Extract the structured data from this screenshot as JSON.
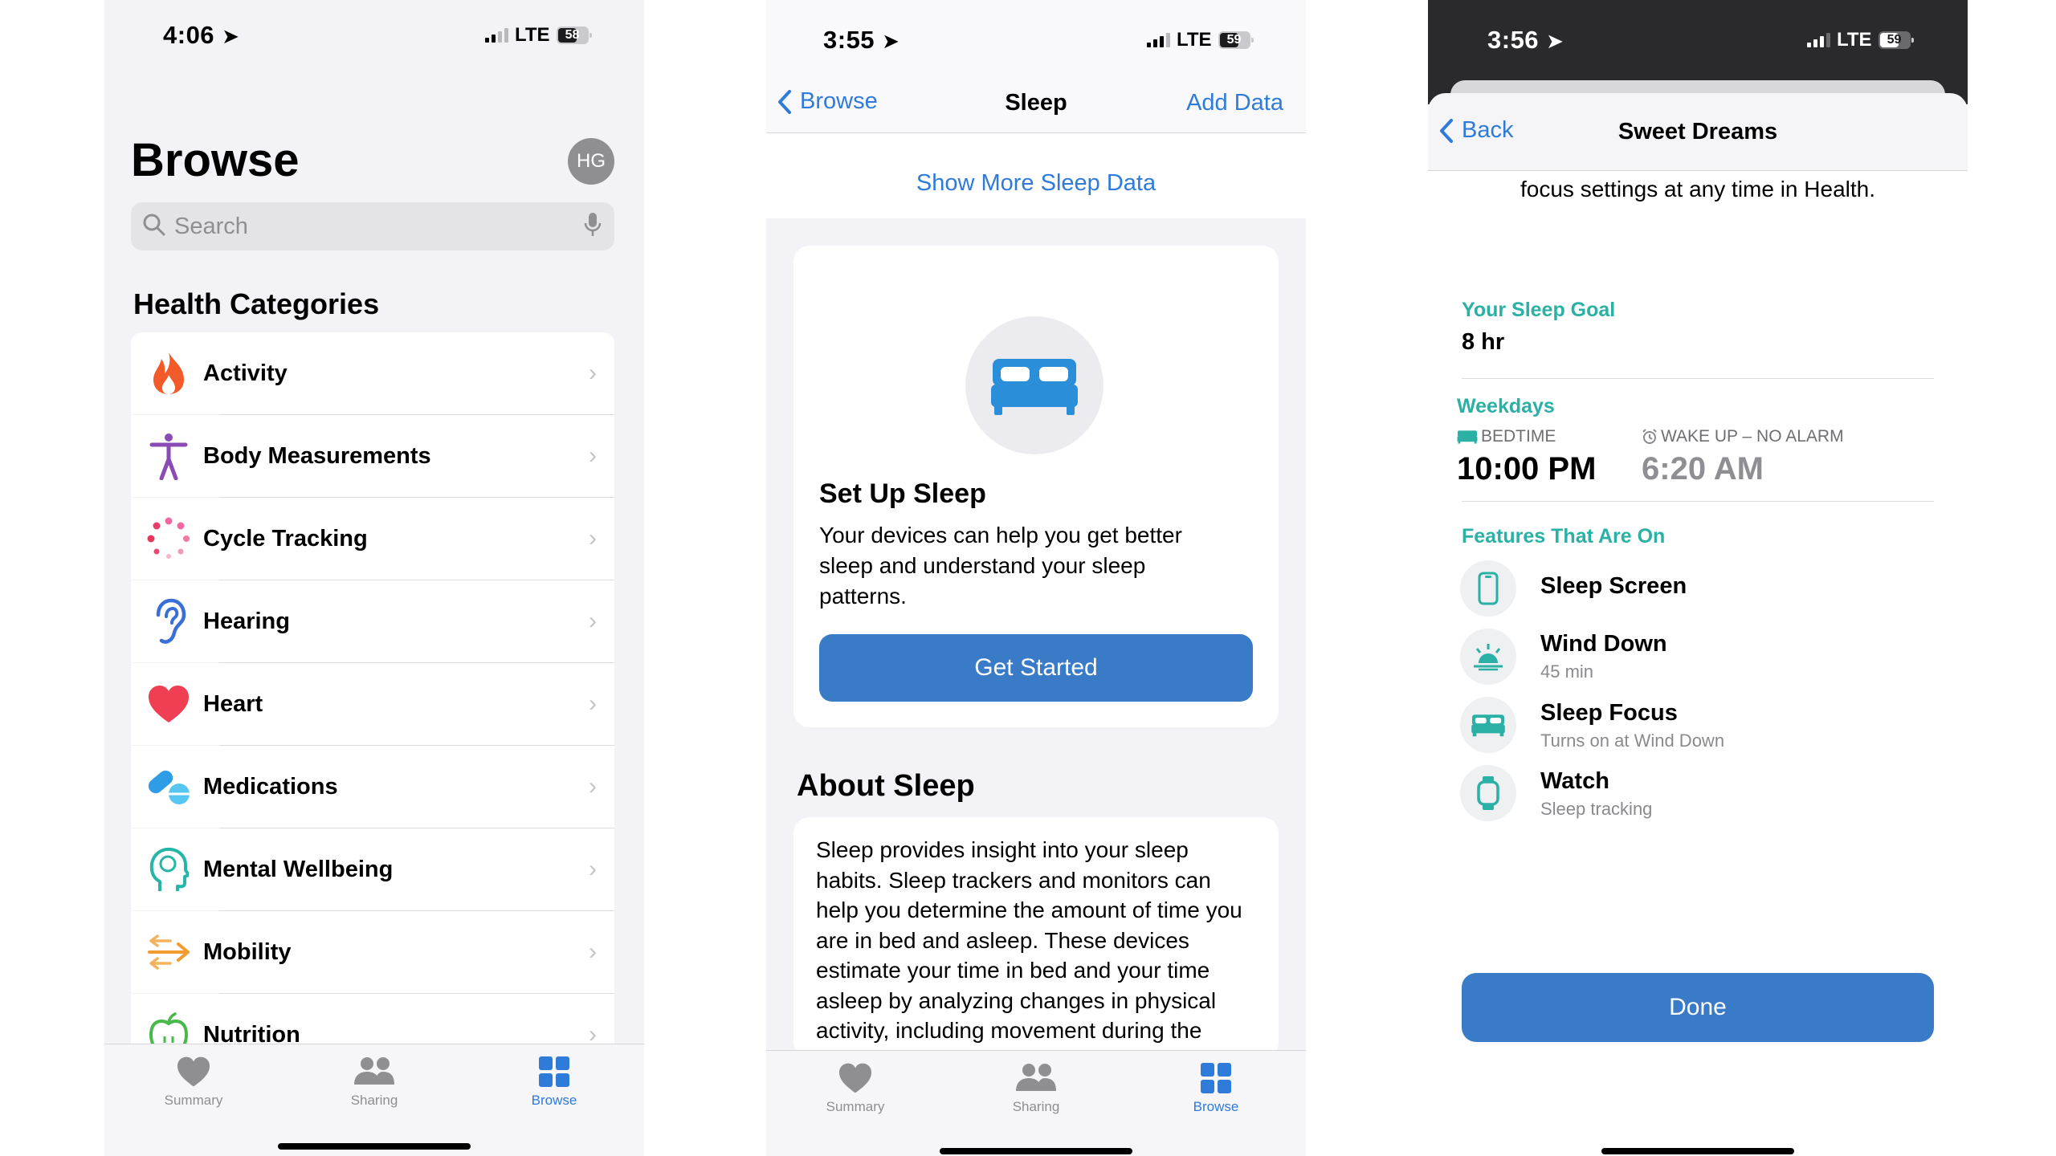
{
  "screen1": {
    "status": {
      "time": "4:06",
      "network": "LTE",
      "battery": "58"
    },
    "title": "Browse",
    "avatar": "HG",
    "search": {
      "placeholder": "Search"
    },
    "section_title": "Health Categories",
    "categories": [
      {
        "label": "Activity",
        "icon": "flame-icon"
      },
      {
        "label": "Body Measurements",
        "icon": "figure-icon"
      },
      {
        "label": "Cycle Tracking",
        "icon": "cycle-dots-icon"
      },
      {
        "label": "Hearing",
        "icon": "ear-icon"
      },
      {
        "label": "Heart",
        "icon": "heart-icon"
      },
      {
        "label": "Medications",
        "icon": "pills-icon"
      },
      {
        "label": "Mental Wellbeing",
        "icon": "head-brain-icon"
      },
      {
        "label": "Mobility",
        "icon": "arrows-icon"
      },
      {
        "label": "Nutrition",
        "icon": "apple-icon"
      }
    ],
    "tabs": [
      {
        "label": "Summary",
        "icon": "heart-icon"
      },
      {
        "label": "Sharing",
        "icon": "people-icon"
      },
      {
        "label": "Browse",
        "icon": "grid-icon"
      }
    ]
  },
  "screen2": {
    "status": {
      "time": "3:55",
      "network": "LTE",
      "battery": "59"
    },
    "nav": {
      "back": "Browse",
      "title": "Sleep",
      "action": "Add Data"
    },
    "show_more": "Show More Sleep Data",
    "card": {
      "title": "Set Up Sleep",
      "body": "Your devices can help you get better sleep and understand your sleep patterns.",
      "button": "Get Started"
    },
    "about_title": "About Sleep",
    "about_body": "Sleep provides insight into your sleep habits. Sleep trackers and monitors can help you determine the amount of time you are in bed and asleep. These devices estimate your time in bed and your time asleep by analyzing changes in physical activity, including movement during the",
    "tabs": [
      {
        "label": "Summary",
        "icon": "heart-icon"
      },
      {
        "label": "Sharing",
        "icon": "people-icon"
      },
      {
        "label": "Browse",
        "icon": "grid-icon"
      }
    ]
  },
  "screen3": {
    "status": {
      "time": "3:56",
      "network": "LTE",
      "battery": "59"
    },
    "nav": {
      "back": "Back",
      "title": "Sweet Dreams"
    },
    "intro": "focus settings at any time in Health.",
    "goal_label": "Your Sleep Goal",
    "goal_value": "8 hr",
    "schedule_label": "Weekdays",
    "bedtime_label": "BEDTIME",
    "bedtime_value": "10:00 PM",
    "wake_label": "WAKE UP – NO ALARM",
    "wake_value": "6:20 AM",
    "features_label": "Features That Are On",
    "features": [
      {
        "title": "Sleep Screen",
        "subtitle": "",
        "icon": "phone-icon"
      },
      {
        "title": "Wind Down",
        "subtitle": "45 min",
        "icon": "sunrise-icon"
      },
      {
        "title": "Sleep Focus",
        "subtitle": "Turns on at Wind Down",
        "icon": "bed-icon"
      },
      {
        "title": "Watch",
        "subtitle": "Sleep tracking",
        "icon": "watch-icon"
      }
    ],
    "done": "Done"
  },
  "colors": {
    "accent": "#2f7bd9",
    "teal": "#2ab0a5",
    "button": "#3a7bc8"
  }
}
